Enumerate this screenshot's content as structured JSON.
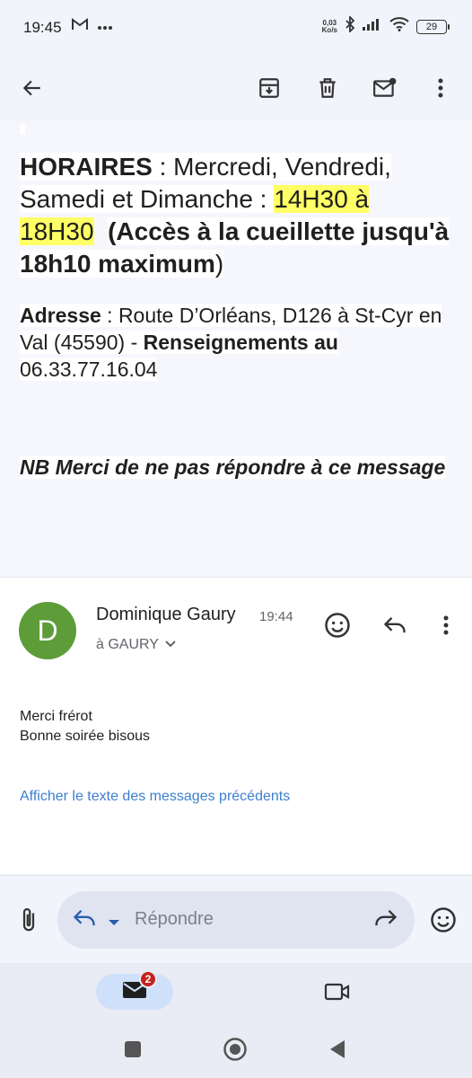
{
  "status_bar": {
    "time": "19:45",
    "netspeed_value": "0,03",
    "netspeed_unit": "Ko/s",
    "battery": "29",
    "icons": [
      "gmail-icon",
      "more-dots-icon",
      "bluetooth-icon",
      "signal-icon",
      "wifi-icon",
      "battery-icon"
    ]
  },
  "toolbar": {
    "icons": [
      "back-arrow-icon",
      "archive-icon",
      "delete-icon",
      "mark-unread-icon",
      "more-vert-icon"
    ]
  },
  "email_top": {
    "hours_label": "HORAIRES",
    "hours_days": " : Mercredi, Vendredi, Samedi et Dimanche : ",
    "hours_time": "14H30 à 18H30",
    "hours_note": "(Accès à la cueillette jusqu'à 18h10 maximum",
    "hours_close": ")",
    "address_label": "Adresse",
    "address_value": " : Route D’Orléans, D126 à St-Cyr en Val (45590) - ",
    "info_label": "Renseignements au",
    "phone": "06.33.77.16.04",
    "nb_text": "NB Merci de ne pas répondre à ce message"
  },
  "message": {
    "avatar_letter": "D",
    "avatar_color": "#5e9c3a",
    "sender": "Dominique Gaury",
    "time": "19:44",
    "recipient": "à GAURY",
    "body_line1": "Merci frérot",
    "body_line2": "Bonne soirée bisous",
    "show_quoted": "Afficher le texte des messages précédents"
  },
  "reply_bar": {
    "placeholder": "Répondre"
  },
  "bottom_nav": {
    "mail_badge": "2"
  },
  "colors": {
    "accent_link": "#3d7fce",
    "highlight_yellow": "#ffff66",
    "badge_red": "#c5221f"
  }
}
